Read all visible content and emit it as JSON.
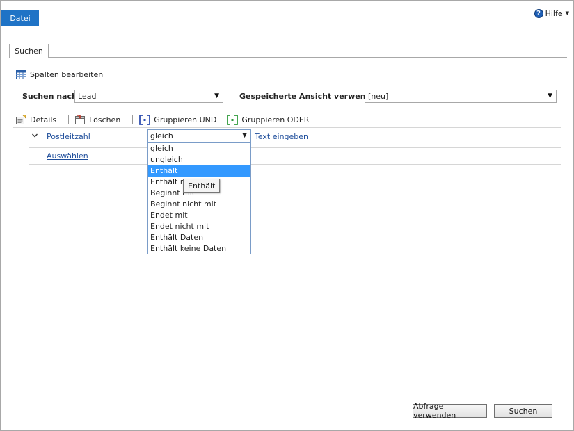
{
  "topbar": {
    "file_tab": "Datei",
    "help_label": "Hilfe"
  },
  "tabs": [
    {
      "label": "Suchen"
    }
  ],
  "toolbar_top": {
    "edit_columns": "Spalten bearbeiten"
  },
  "search": {
    "search_for_label": "Suchen nach:",
    "search_for_value": "Lead",
    "saved_view_label": "Gespeicherte Ansicht verwenden:",
    "saved_view_value": "[neu]"
  },
  "actions": {
    "details": "Details",
    "delete": "Löschen",
    "group_and": "Gruppieren UND",
    "group_or": "Gruppieren ODER"
  },
  "criteria": {
    "field": "Postleitzahl",
    "operator": "gleich",
    "value_link": "Text eingeben",
    "select_link": "Auswählen"
  },
  "operator_options": [
    {
      "label": "gleich",
      "selected": false
    },
    {
      "label": "ungleich",
      "selected": false
    },
    {
      "label": "Enthält",
      "selected": true
    },
    {
      "label": "Enthält nicht",
      "selected": false
    },
    {
      "label": "Beginnt mit",
      "selected": false
    },
    {
      "label": "Beginnt nicht mit",
      "selected": false
    },
    {
      "label": "Endet mit",
      "selected": false
    },
    {
      "label": "Endet nicht mit",
      "selected": false
    },
    {
      "label": "Enthält Daten",
      "selected": false
    },
    {
      "label": "Enthält keine Daten",
      "selected": false
    }
  ],
  "tooltip": "Enthält",
  "buttons": {
    "use_query": "Abfrage verwenden",
    "search": "Suchen"
  },
  "colors": {
    "accent": "#1f73c6",
    "selection": "#3399ff",
    "link": "#1f4e9b"
  }
}
